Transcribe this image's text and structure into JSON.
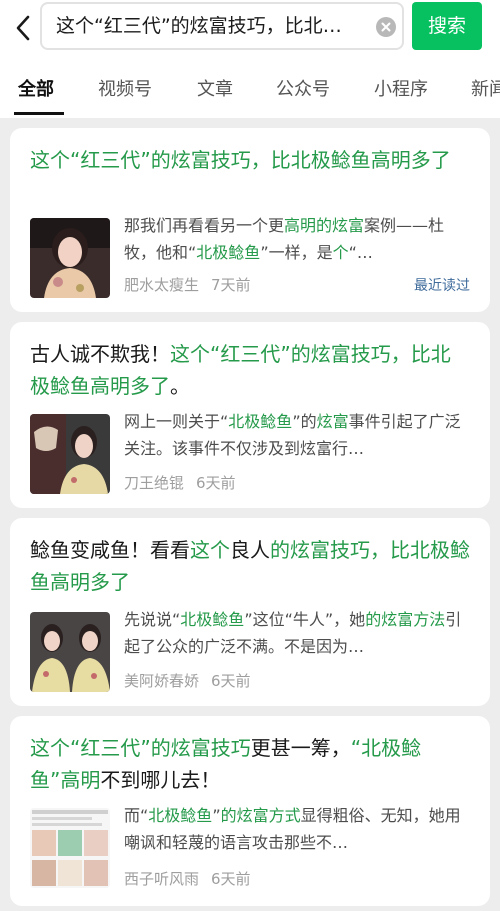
{
  "search": {
    "query": "这个“红三代”的炫富技巧，比北极鲶鱼高明多了",
    "button_label": "搜索"
  },
  "tabs": [
    {
      "label": "全部",
      "active": true
    },
    {
      "label": "视频号",
      "active": false
    },
    {
      "label": "文章",
      "active": false
    },
    {
      "label": "公众号",
      "active": false
    },
    {
      "label": "小程序",
      "active": false
    },
    {
      "label": "新闻",
      "active": false
    }
  ],
  "results": [
    {
      "title_segments": [
        {
          "text": "这个“红三代”的炫富技巧，比北极鲶鱼高明多了",
          "hl": true
        }
      ],
      "snippet_segments": [
        {
          "text": "那我们再看看另一个更",
          "hl": false
        },
        {
          "text": "高明的炫富",
          "hl": true
        },
        {
          "text": "案例——杜牧，他和“",
          "hl": false
        },
        {
          "text": "北极鲶鱼",
          "hl": true
        },
        {
          "text": "”一样，是",
          "hl": false
        },
        {
          "text": "个",
          "hl": true
        },
        {
          "text": "“…",
          "hl": false
        }
      ],
      "author": "肥水太瘦生",
      "age": "7天前",
      "recent_label": "最近读过"
    },
    {
      "title_segments": [
        {
          "text": "古人诚不欺我！",
          "hl": false
        },
        {
          "text": "这个“红三代”的炫富技巧，比北极鲶鱼高明多了",
          "hl": true
        },
        {
          "text": "。",
          "hl": false
        }
      ],
      "snippet_segments": [
        {
          "text": "网上一则关于“",
          "hl": false
        },
        {
          "text": "北极鲶鱼",
          "hl": true
        },
        {
          "text": "”的",
          "hl": false
        },
        {
          "text": "炫富",
          "hl": true
        },
        {
          "text": "事件引起了广泛关注。该事件不仅涉及到炫富行…",
          "hl": false
        }
      ],
      "author": "刀王绝锟",
      "age": "6天前",
      "recent_label": ""
    },
    {
      "title_segments": [
        {
          "text": "鲶鱼变咸鱼！看看",
          "hl": false
        },
        {
          "text": "这个",
          "hl": true
        },
        {
          "text": "良人",
          "hl": false
        },
        {
          "text": "的炫富技巧，比北极鲶鱼高明多了",
          "hl": true
        }
      ],
      "snippet_segments": [
        {
          "text": "先说说“",
          "hl": false
        },
        {
          "text": "北极鲶鱼",
          "hl": true
        },
        {
          "text": "”这位“牛人”，她",
          "hl": false
        },
        {
          "text": "的炫富方法",
          "hl": true
        },
        {
          "text": "引起了公众的广泛不满。不是因为…",
          "hl": false
        }
      ],
      "author": "美阿娇春娇",
      "age": "6天前",
      "recent_label": ""
    },
    {
      "title_segments": [
        {
          "text": "这个“红三代”的炫富技巧",
          "hl": true
        },
        {
          "text": "更甚一筹，",
          "hl": false
        },
        {
          "text": "“北极鲶鱼”高明",
          "hl": true
        },
        {
          "text": "不到哪儿去！",
          "hl": false
        }
      ],
      "snippet_segments": [
        {
          "text": "而“",
          "hl": false
        },
        {
          "text": "北极鲶鱼",
          "hl": true
        },
        {
          "text": "”",
          "hl": false
        },
        {
          "text": "的炫富方式",
          "hl": true
        },
        {
          "text": "显得粗俗、无知，她用嘲讽和轻蔑的语言攻击那些不…",
          "hl": false
        }
      ],
      "author": "西子听风雨",
      "age": "6天前",
      "recent_label": ""
    }
  ],
  "colors": {
    "accent_green": "#07c160",
    "highlight_green": "#259a4a",
    "recent_blue": "#3f6b9b"
  },
  "icons": {
    "back": "back-arrow-icon",
    "clear": "clear-icon"
  }
}
